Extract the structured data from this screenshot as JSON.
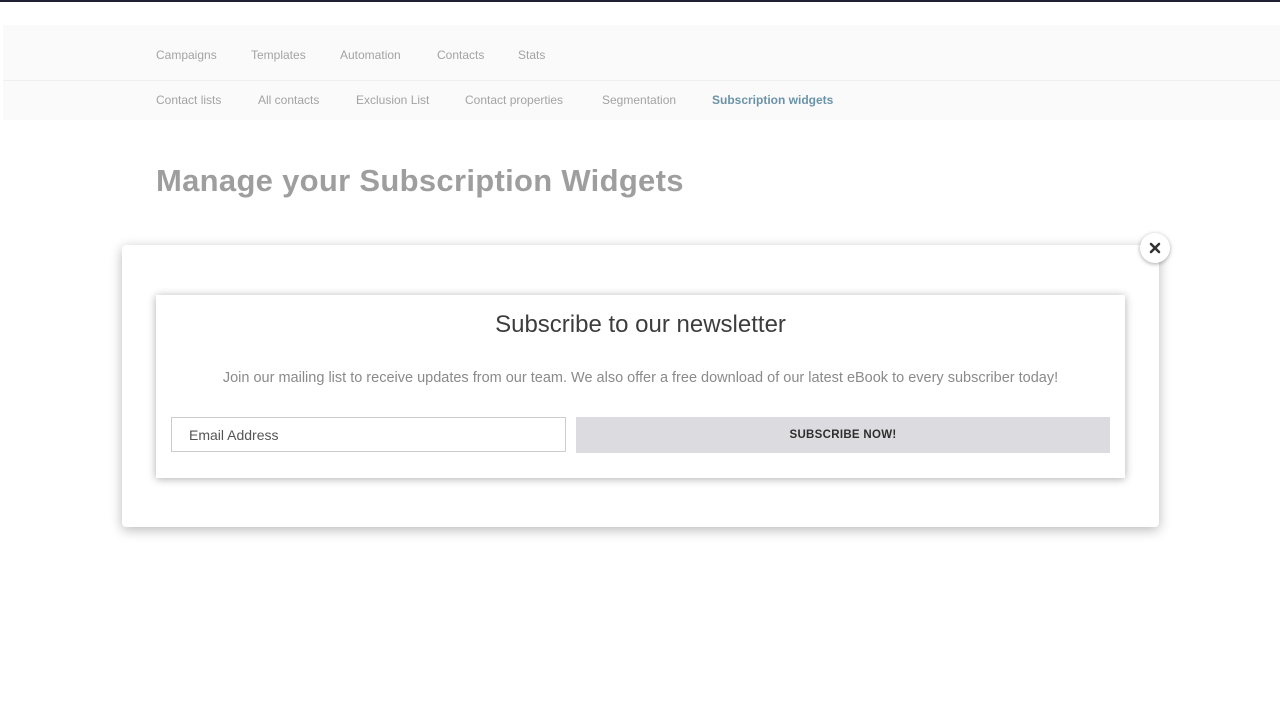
{
  "nav": {
    "primary": [
      {
        "label": "Campaigns",
        "active": false
      },
      {
        "label": "Templates",
        "active": false
      },
      {
        "label": "Automation",
        "active": false
      },
      {
        "label": "Contacts",
        "active": false
      },
      {
        "label": "Stats",
        "active": false
      }
    ],
    "secondary": [
      {
        "label": "Contact lists",
        "active": false
      },
      {
        "label": "All contacts",
        "active": false
      },
      {
        "label": "Exclusion List",
        "active": false
      },
      {
        "label": "Contact properties",
        "active": false
      },
      {
        "label": "Segmentation",
        "active": false
      },
      {
        "label": "Subscription widgets",
        "active": true
      }
    ]
  },
  "page": {
    "title": "Manage your Subscription Widgets"
  },
  "modal": {
    "close_icon": "close-icon"
  },
  "widget": {
    "title": "Subscribe to our newsletter",
    "description": "Join our mailing list to receive updates from our team. We also offer a free download of our latest eBook to every subscriber today!",
    "email_placeholder": "Email Address",
    "email_value": "",
    "button_label": "SUBSCRIBE NOW!"
  },
  "colors": {
    "active_nav": "#6b93a8",
    "button_bg": "#dcdce0",
    "top_strip": "#1f2033"
  }
}
